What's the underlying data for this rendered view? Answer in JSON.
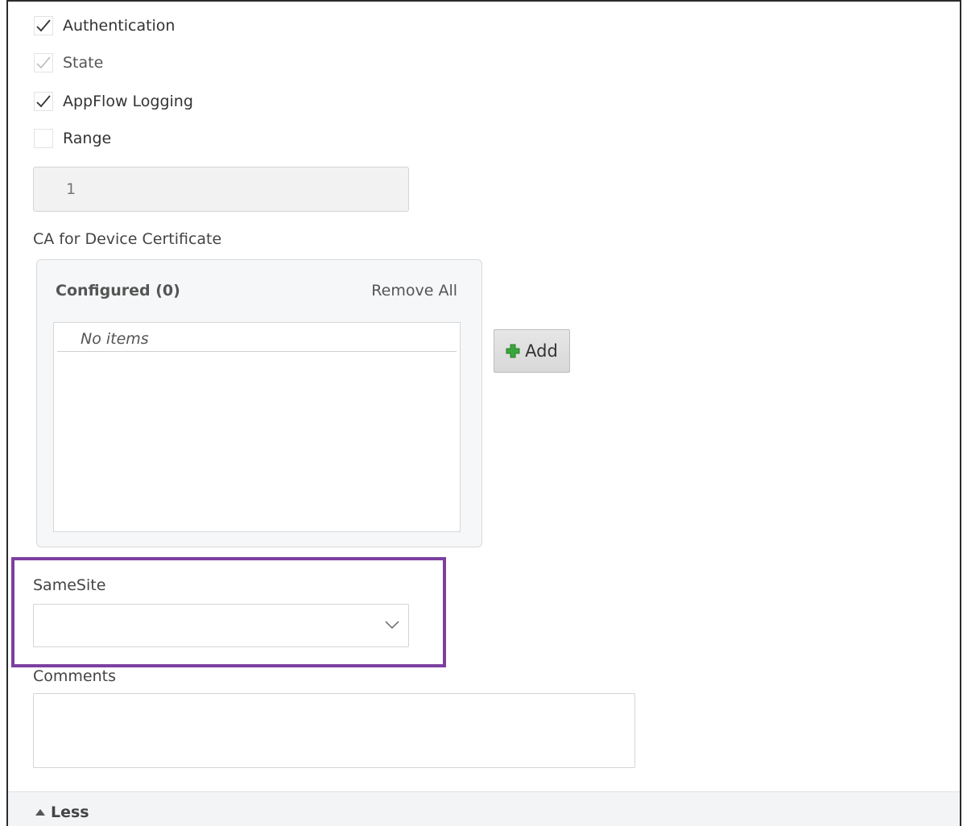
{
  "options": {
    "authentication": {
      "label": "Authentication",
      "checked": true
    },
    "state": {
      "label": "State",
      "checked": true,
      "disabled": true
    },
    "appflow_logging": {
      "label": "AppFlow Logging",
      "checked": true
    },
    "range": {
      "label": "Range",
      "checked": false
    }
  },
  "range_value": "1",
  "ca_device_certificate": {
    "label": "CA for Device Certificate",
    "configured_title": "Configured (0)",
    "remove_all_label": "Remove All",
    "empty_text": "No items",
    "add_label": "Add"
  },
  "samesite": {
    "label": "SameSite",
    "selected_value": ""
  },
  "comments": {
    "label": "Comments",
    "value": ""
  },
  "footer": {
    "toggle_label": "Less"
  },
  "colors": {
    "highlight_border": "#7c3fa0",
    "plus_icon": "#3aa63a",
    "check_mark": "#333333",
    "check_mark_disabled": "#b0b0b0"
  }
}
